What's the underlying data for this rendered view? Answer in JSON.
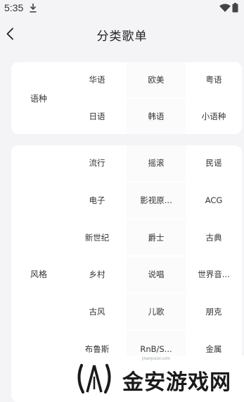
{
  "status_bar": {
    "time": "5:35"
  },
  "header": {
    "title": "分类歌单"
  },
  "language": {
    "label": "语种",
    "items": [
      "华语",
      "欧美",
      "粤语",
      "日语",
      "韩语",
      "小语种"
    ]
  },
  "style": {
    "label": "风格",
    "items": [
      "流行",
      "摇滚",
      "民谣",
      "电子",
      "影视原...",
      "ACG",
      "新世纪",
      "爵士",
      "古典",
      "乡村",
      "说唱",
      "世界音...",
      "古风",
      "儿歌",
      "朋克",
      "布鲁斯",
      "RnB/S...",
      "金属"
    ]
  },
  "watermark": {
    "text": "金安游戏网",
    "small": "jinanyouxi.com"
  },
  "colors": {
    "background": "#f4f4f6",
    "card": "#ffffff",
    "text": "#333333"
  }
}
